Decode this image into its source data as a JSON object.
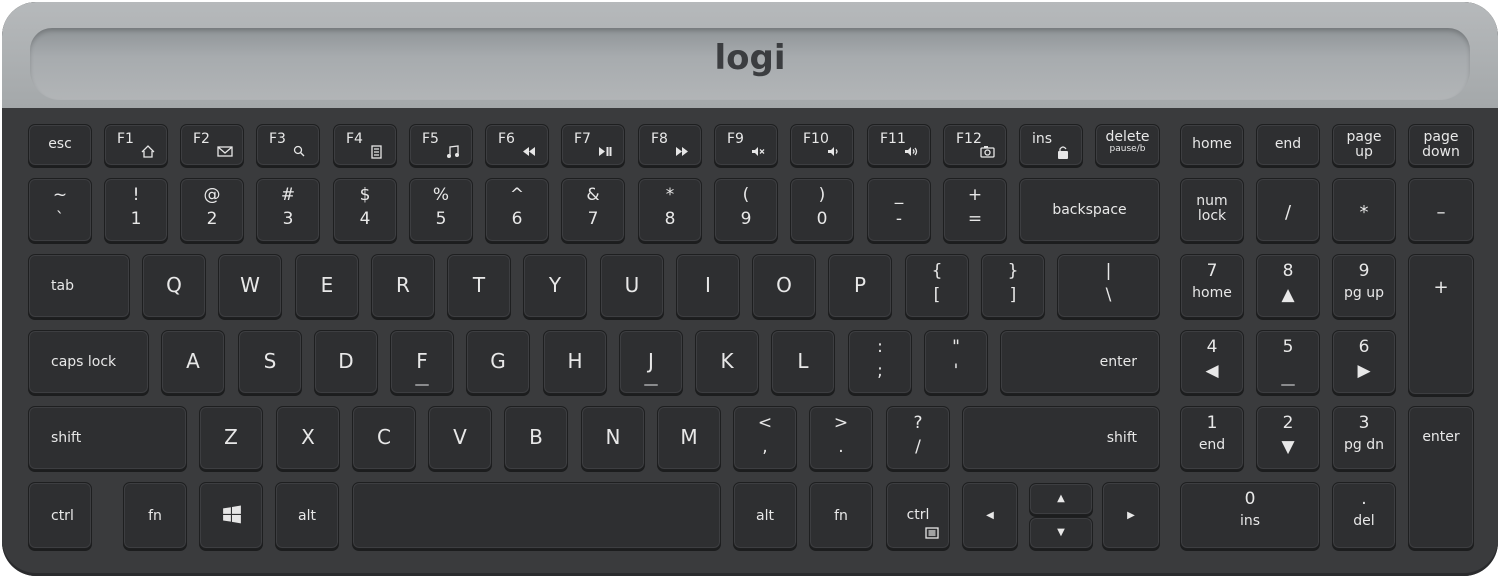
{
  "brand": {
    "logo_text": "logi"
  },
  "rows": {
    "fn_row": [
      {
        "id": "esc",
        "label": "esc"
      },
      {
        "id": "f1",
        "label": "F1",
        "icon": "home-icon"
      },
      {
        "id": "f2",
        "label": "F2",
        "icon": "mail-icon"
      },
      {
        "id": "f3",
        "label": "F3",
        "icon": "search-icon"
      },
      {
        "id": "f4",
        "label": "F4",
        "icon": "calculator-icon"
      },
      {
        "id": "f5",
        "label": "F5",
        "icon": "music-icon"
      },
      {
        "id": "f6",
        "label": "F6",
        "icon": "rewind-icon"
      },
      {
        "id": "f7",
        "label": "F7",
        "icon": "play-pause-icon"
      },
      {
        "id": "f8",
        "label": "F8",
        "icon": "fast-forward-icon"
      },
      {
        "id": "f9",
        "label": "F9",
        "icon": "mute-icon"
      },
      {
        "id": "f10",
        "label": "F10",
        "icon": "volume-down-icon"
      },
      {
        "id": "f11",
        "label": "F11",
        "icon": "volume-up-icon"
      },
      {
        "id": "f12",
        "label": "F12",
        "icon": "camera-icon"
      },
      {
        "id": "ins",
        "label": "ins",
        "icon": "scroll-lock-icon"
      },
      {
        "id": "delete",
        "label": "delete",
        "sub": "pause/b"
      },
      {
        "id": "home",
        "label": "home"
      },
      {
        "id": "end",
        "label": "end"
      },
      {
        "id": "pageup",
        "label": "page",
        "sub": "up"
      },
      {
        "id": "pagedown",
        "label": "page",
        "sub": "down"
      }
    ],
    "num_row": [
      {
        "id": "grave",
        "top": "~",
        "bottom": "`"
      },
      {
        "id": "1",
        "top": "!",
        "bottom": "1"
      },
      {
        "id": "2",
        "top": "@",
        "bottom": "2"
      },
      {
        "id": "3",
        "top": "#",
        "bottom": "3"
      },
      {
        "id": "4",
        "top": "$",
        "bottom": "4"
      },
      {
        "id": "5",
        "top": "%",
        "bottom": "5"
      },
      {
        "id": "6",
        "top": "^",
        "bottom": "6"
      },
      {
        "id": "7",
        "top": "&",
        "bottom": "7"
      },
      {
        "id": "8",
        "top": "*",
        "bottom": "8"
      },
      {
        "id": "9",
        "top": "(",
        "bottom": "9"
      },
      {
        "id": "0",
        "top": ")",
        "bottom": "0"
      },
      {
        "id": "minus",
        "top": "_",
        "bottom": "-"
      },
      {
        "id": "equals",
        "top": "+",
        "bottom": "="
      },
      {
        "id": "backspace",
        "label": "backspace"
      },
      {
        "id": "numlock",
        "label": "num",
        "sub": "lock"
      },
      {
        "id": "kp-divide",
        "label": "/"
      },
      {
        "id": "kp-multiply",
        "label": "*"
      },
      {
        "id": "kp-minus",
        "label": "–"
      }
    ],
    "q_row": [
      {
        "id": "tab",
        "label": "tab"
      },
      {
        "id": "q",
        "label": "Q"
      },
      {
        "id": "w",
        "label": "W"
      },
      {
        "id": "e",
        "label": "E"
      },
      {
        "id": "r",
        "label": "R"
      },
      {
        "id": "t",
        "label": "T"
      },
      {
        "id": "y",
        "label": "Y"
      },
      {
        "id": "u",
        "label": "U"
      },
      {
        "id": "i",
        "label": "I"
      },
      {
        "id": "o",
        "label": "O"
      },
      {
        "id": "p",
        "label": "P"
      },
      {
        "id": "lbracket",
        "top": "{",
        "bottom": "["
      },
      {
        "id": "rbracket",
        "top": "}",
        "bottom": "]"
      },
      {
        "id": "backslash",
        "top": "|",
        "bottom": "\\"
      },
      {
        "id": "kp7",
        "top": "7",
        "bottom": "home"
      },
      {
        "id": "kp8",
        "top": "8",
        "bottom": "▲"
      },
      {
        "id": "kp9",
        "top": "9",
        "bottom": "pg up"
      },
      {
        "id": "kp-plus",
        "label": "+"
      }
    ],
    "a_row": [
      {
        "id": "capslock",
        "label": "caps lock"
      },
      {
        "id": "a",
        "label": "A"
      },
      {
        "id": "s",
        "label": "S"
      },
      {
        "id": "d",
        "label": "D"
      },
      {
        "id": "f",
        "label": "F"
      },
      {
        "id": "g",
        "label": "G"
      },
      {
        "id": "h",
        "label": "H"
      },
      {
        "id": "j",
        "label": "J"
      },
      {
        "id": "k",
        "label": "K"
      },
      {
        "id": "l",
        "label": "L"
      },
      {
        "id": "semicolon",
        "top": ":",
        "bottom": ";"
      },
      {
        "id": "quote",
        "top": "\"",
        "bottom": "'"
      },
      {
        "id": "enter",
        "label": "enter"
      },
      {
        "id": "kp4",
        "top": "4",
        "bottom": "◀"
      },
      {
        "id": "kp5",
        "top": "5",
        "bottom": ""
      },
      {
        "id": "kp6",
        "top": "6",
        "bottom": "▶"
      }
    ],
    "z_row": [
      {
        "id": "lshift",
        "label": "shift"
      },
      {
        "id": "z",
        "label": "Z"
      },
      {
        "id": "x",
        "label": "X"
      },
      {
        "id": "c",
        "label": "C"
      },
      {
        "id": "v",
        "label": "V"
      },
      {
        "id": "b",
        "label": "B"
      },
      {
        "id": "n",
        "label": "N"
      },
      {
        "id": "m",
        "label": "M"
      },
      {
        "id": "comma",
        "top": "<",
        "bottom": ","
      },
      {
        "id": "period",
        "top": ">",
        "bottom": "."
      },
      {
        "id": "slash",
        "top": "?",
        "bottom": "/"
      },
      {
        "id": "rshift",
        "label": "shift"
      },
      {
        "id": "kp1",
        "top": "1",
        "bottom": "end"
      },
      {
        "id": "kp2",
        "top": "2",
        "bottom": "▼"
      },
      {
        "id": "kp3",
        "top": "3",
        "bottom": "pg dn"
      },
      {
        "id": "kp-enter",
        "label": "enter"
      }
    ],
    "bottom_row": [
      {
        "id": "lctrl",
        "label": "ctrl"
      },
      {
        "id": "fn",
        "label": "fn"
      },
      {
        "id": "win",
        "label": "",
        "icon": "windows-icon"
      },
      {
        "id": "lalt",
        "label": "alt"
      },
      {
        "id": "space",
        "label": ""
      },
      {
        "id": "ralt",
        "label": "alt"
      },
      {
        "id": "rfn",
        "label": "fn"
      },
      {
        "id": "rctrl",
        "label": "ctrl",
        "icon": "menu-icon"
      },
      {
        "id": "left",
        "label": "◀"
      },
      {
        "id": "up",
        "label": "▲"
      },
      {
        "id": "down",
        "label": "▼"
      },
      {
        "id": "right",
        "label": "▶"
      },
      {
        "id": "kp0",
        "top": "0",
        "bottom": "ins"
      },
      {
        "id": "kp-dot",
        "top": ".",
        "bottom": "del"
      }
    ]
  },
  "colors": {
    "key": "#2e2f31",
    "case": "#3a3b3d",
    "top_panel": "#aeb1b3",
    "legend": "#e8e8e8"
  }
}
